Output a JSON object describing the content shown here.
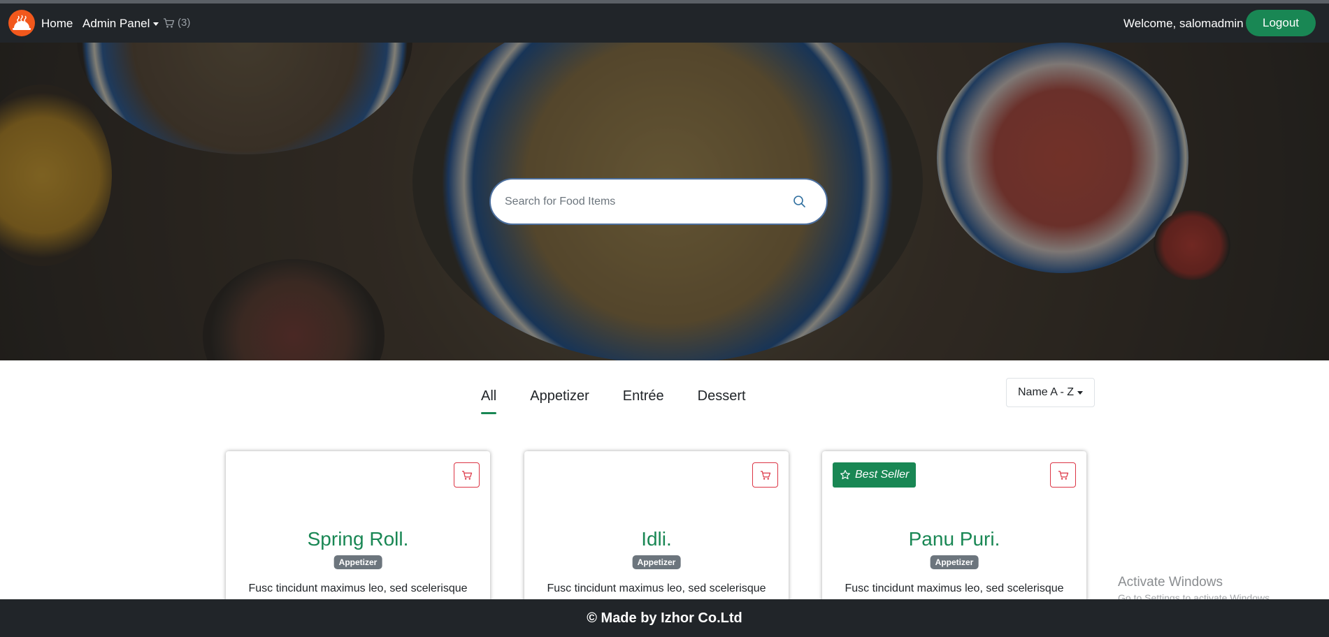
{
  "navbar": {
    "home_label": "Home",
    "admin_label": "Admin Panel",
    "cart_count": "(3)",
    "welcome_text": "Welcome, salomadmin",
    "logout_label": "Logout"
  },
  "hero": {
    "search_placeholder": "Search for Food Items"
  },
  "filters": {
    "tabs": [
      "All",
      "Appetizer",
      "Entrée",
      "Dessert"
    ],
    "active_tab": "All",
    "sort_label": "Name A - Z"
  },
  "cards": [
    {
      "title": "Spring Roll.",
      "category": "Appetizer",
      "description": "Fusc tincidunt maximus leo, sed scelerisque",
      "best_seller": ""
    },
    {
      "title": "Idli.",
      "category": "Appetizer",
      "description": "Fusc tincidunt maximus leo, sed scelerisque",
      "best_seller": ""
    },
    {
      "title": "Panu Puri.",
      "category": "Appetizer",
      "description": "Fusc tincidunt maximus leo, sed scelerisque",
      "best_seller": "Best Seller"
    }
  ],
  "watermark": {
    "title": "Activate Windows",
    "subtitle": "Go to Settings to activate Windows."
  },
  "footer": {
    "text": "© Made by Izhor Co.Ltd"
  },
  "colors": {
    "navbar_bg": "#212529",
    "accent_green": "#198754",
    "cart_red": "#dc3545",
    "logo_orange": "#f2581c",
    "badge_gray": "#6c757d"
  },
  "icons": {
    "logo": "serving-dish-icon",
    "cart": "cart-icon",
    "search": "search-icon",
    "star": "star-icon"
  }
}
